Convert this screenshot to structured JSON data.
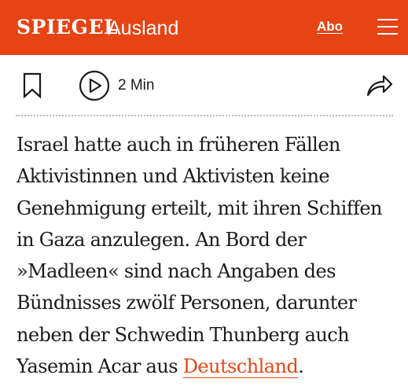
{
  "header": {
    "logo": "SPIEGEL",
    "section": "Ausland",
    "abo_label": "Abo",
    "menu_icon": "hamburger-menu-icon",
    "background_color": "#e64415"
  },
  "toolbar": {
    "bookmark_icon": "bookmark-icon",
    "play_icon": "play-icon",
    "duration": "2 Min",
    "share_icon": "share-icon"
  },
  "article": {
    "lines": [
      "Israel hatte auch in früheren Fällen",
      "Aktivistinnen und Aktivisten keine",
      "Genehmigung erteilt, mit ihren Schiffen",
      "in Gaza anzulegen. An Bord der",
      "»Madleen« sind nach Angaben des",
      "Bündnisses zwölf Personen, darunter",
      "neben der Schwedin Thunberg auch"
    ],
    "last_line_prefix": "Yasemin Acar aus ",
    "link_text": "Deutschland",
    "last_line_suffix": ".",
    "link_color": "#e64415"
  }
}
